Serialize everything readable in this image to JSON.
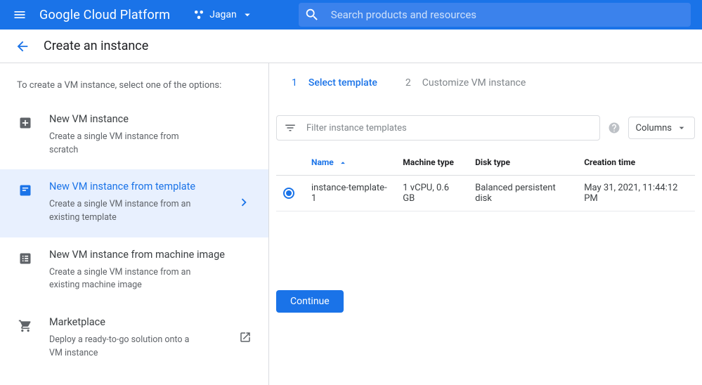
{
  "header": {
    "brand": "Google Cloud Platform",
    "project_name": "Jagan",
    "search_placeholder": "Search products and resources"
  },
  "page": {
    "title": "Create an instance"
  },
  "sidebar": {
    "intro": "To create a VM instance, select one of the options:",
    "options": [
      {
        "title": "New VM instance",
        "desc": "Create a single VM instance from scratch"
      },
      {
        "title": "New VM instance from template",
        "desc": "Create a single VM instance from an existing template"
      },
      {
        "title": "New VM instance from machine image",
        "desc": "Create a single VM instance from an existing machine image"
      },
      {
        "title": "Marketplace",
        "desc": "Deploy a ready-to-go solution onto a VM instance"
      }
    ]
  },
  "steps": [
    {
      "num": "1",
      "label": "Select template"
    },
    {
      "num": "2",
      "label": "Customize VM instance"
    }
  ],
  "filter": {
    "placeholder": "Filter instance templates",
    "columns_label": "Columns"
  },
  "table": {
    "headers": {
      "name": "Name",
      "machine_type": "Machine type",
      "disk_type": "Disk type",
      "creation_time": "Creation time"
    },
    "rows": [
      {
        "name": "instance-template-1",
        "machine_type": "1 vCPU, 0.6 GB",
        "disk_type": "Balanced persistent disk",
        "creation_time": "May 31, 2021, 11:44:12 PM"
      }
    ]
  },
  "actions": {
    "continue": "Continue"
  }
}
